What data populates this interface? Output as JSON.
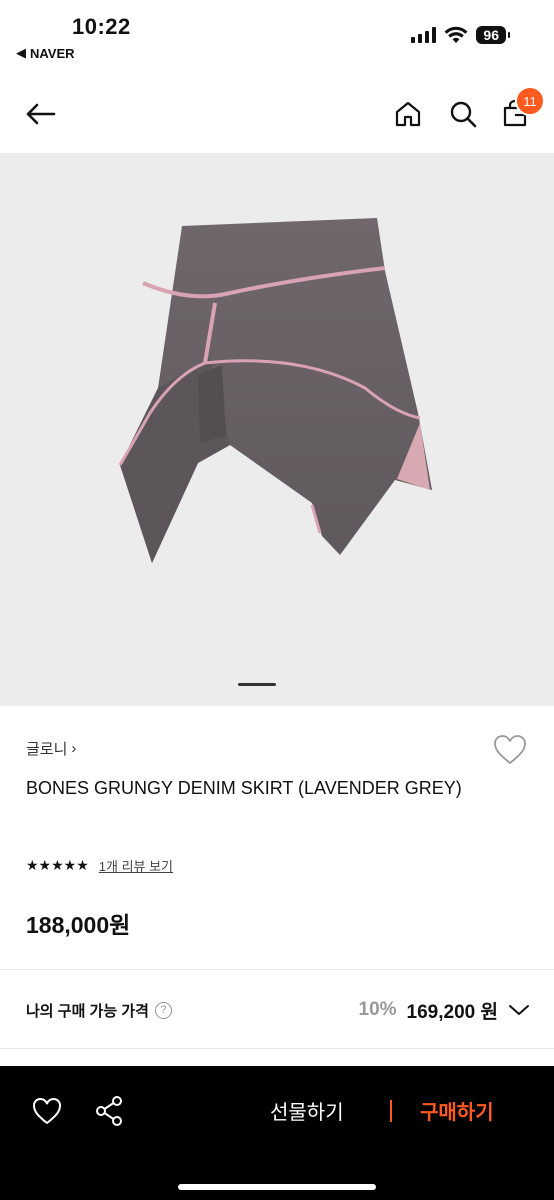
{
  "status_bar": {
    "time": "10:22",
    "back_app": "NAVER",
    "battery": "96"
  },
  "header": {
    "cart_count": "11",
    "icons": [
      "back-arrow-icon",
      "home-icon",
      "search-icon",
      "cart-icon"
    ]
  },
  "product": {
    "brand": "글로니",
    "brand_chevron": "›",
    "title": "BONES GRUNGY DENIM SKIRT (LAVENDER GREY)",
    "stars": "★★★★★",
    "rating": 5,
    "review_link": "1개 리뷰 보기",
    "price": "188,000원",
    "image_count": 1,
    "current_image": 1
  },
  "my_price": {
    "label": "나의 구매 가능 가격",
    "help": "?",
    "discount": "10%",
    "sale_price": "169,200 원"
  },
  "bottom_bar": {
    "gift_label": "선물하기",
    "buy_label": "구매하기"
  },
  "colors": {
    "accent": "#ff5a1f",
    "product_bg": "#ececec",
    "bar_bg": "#000000"
  }
}
